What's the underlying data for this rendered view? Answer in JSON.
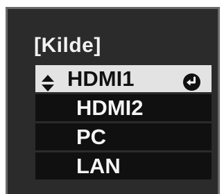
{
  "source_menu": {
    "title": "[Kilde]",
    "items": [
      {
        "label": "HDMI1",
        "selected": true,
        "left_icon": "up-down-arrows-icon",
        "right_icon": "enter-icon"
      },
      {
        "label": "HDMI2",
        "selected": false
      },
      {
        "label": "PC",
        "selected": false
      },
      {
        "label": "LAN",
        "selected": false
      }
    ]
  },
  "colors": {
    "panel_background": "#2b2b2b",
    "item_background": "#101010",
    "selected_background": "#e3e3e3",
    "text": "#f5f5f5",
    "selected_text": "#111111"
  }
}
